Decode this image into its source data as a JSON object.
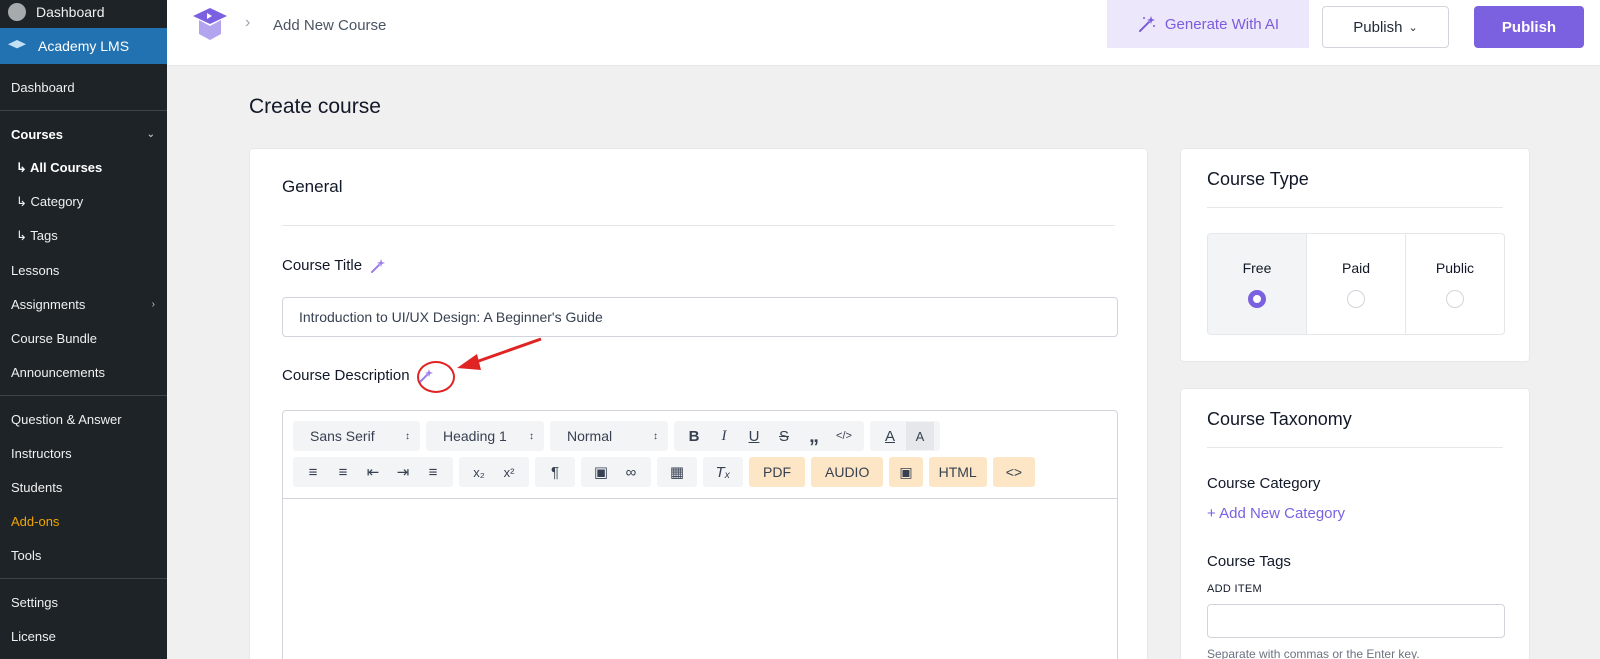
{
  "sidebar": {
    "top_label": "Dashboard",
    "active_label": "Academy LMS",
    "items": [
      {
        "label": "Dashboard"
      },
      {
        "label": "Courses"
      },
      {
        "label": "↳ All Courses"
      },
      {
        "label": "↳ Category"
      },
      {
        "label": "↳ Tags"
      },
      {
        "label": "Lessons"
      },
      {
        "label": "Assignments"
      },
      {
        "label": "Course Bundle"
      },
      {
        "label": "Announcements"
      },
      {
        "label": "Question & Answer"
      },
      {
        "label": "Instructors"
      },
      {
        "label": "Students"
      },
      {
        "label": "Add-ons"
      },
      {
        "label": "Tools"
      },
      {
        "label": "Settings"
      },
      {
        "label": "License"
      }
    ]
  },
  "header": {
    "breadcrumb": "Add New Course",
    "ai_button": "Generate With AI",
    "publish_dropdown": "Publish",
    "publish_button": "Publish"
  },
  "page_title": "Create course",
  "general": {
    "heading": "General",
    "title_label": "Course Title",
    "title_value": "Introduction to UI/UX Design: A Beginner's Guide",
    "description_label": "Course Description"
  },
  "toolbar": {
    "font": "Sans Serif",
    "heading": "Heading 1",
    "size": "Normal",
    "pdf": "PDF",
    "audio": "AUDIO",
    "html": "HTML",
    "code": "<>"
  },
  "course_type": {
    "heading": "Course Type",
    "options": [
      {
        "label": "Free",
        "selected": true
      },
      {
        "label": "Paid",
        "selected": false
      },
      {
        "label": "Public",
        "selected": false
      }
    ]
  },
  "taxonomy": {
    "heading": "Course Taxonomy",
    "category_label": "Course Category",
    "add_category": "+ Add New Category",
    "tags_label": "Course Tags",
    "add_item": "ADD ITEM",
    "help": "Separate with commas or the Enter key."
  },
  "colors": {
    "accent": "#7b61e0",
    "sidebar_bg": "#1d2327",
    "sidebar_active": "#2271b1",
    "annotation": "#e02424"
  }
}
